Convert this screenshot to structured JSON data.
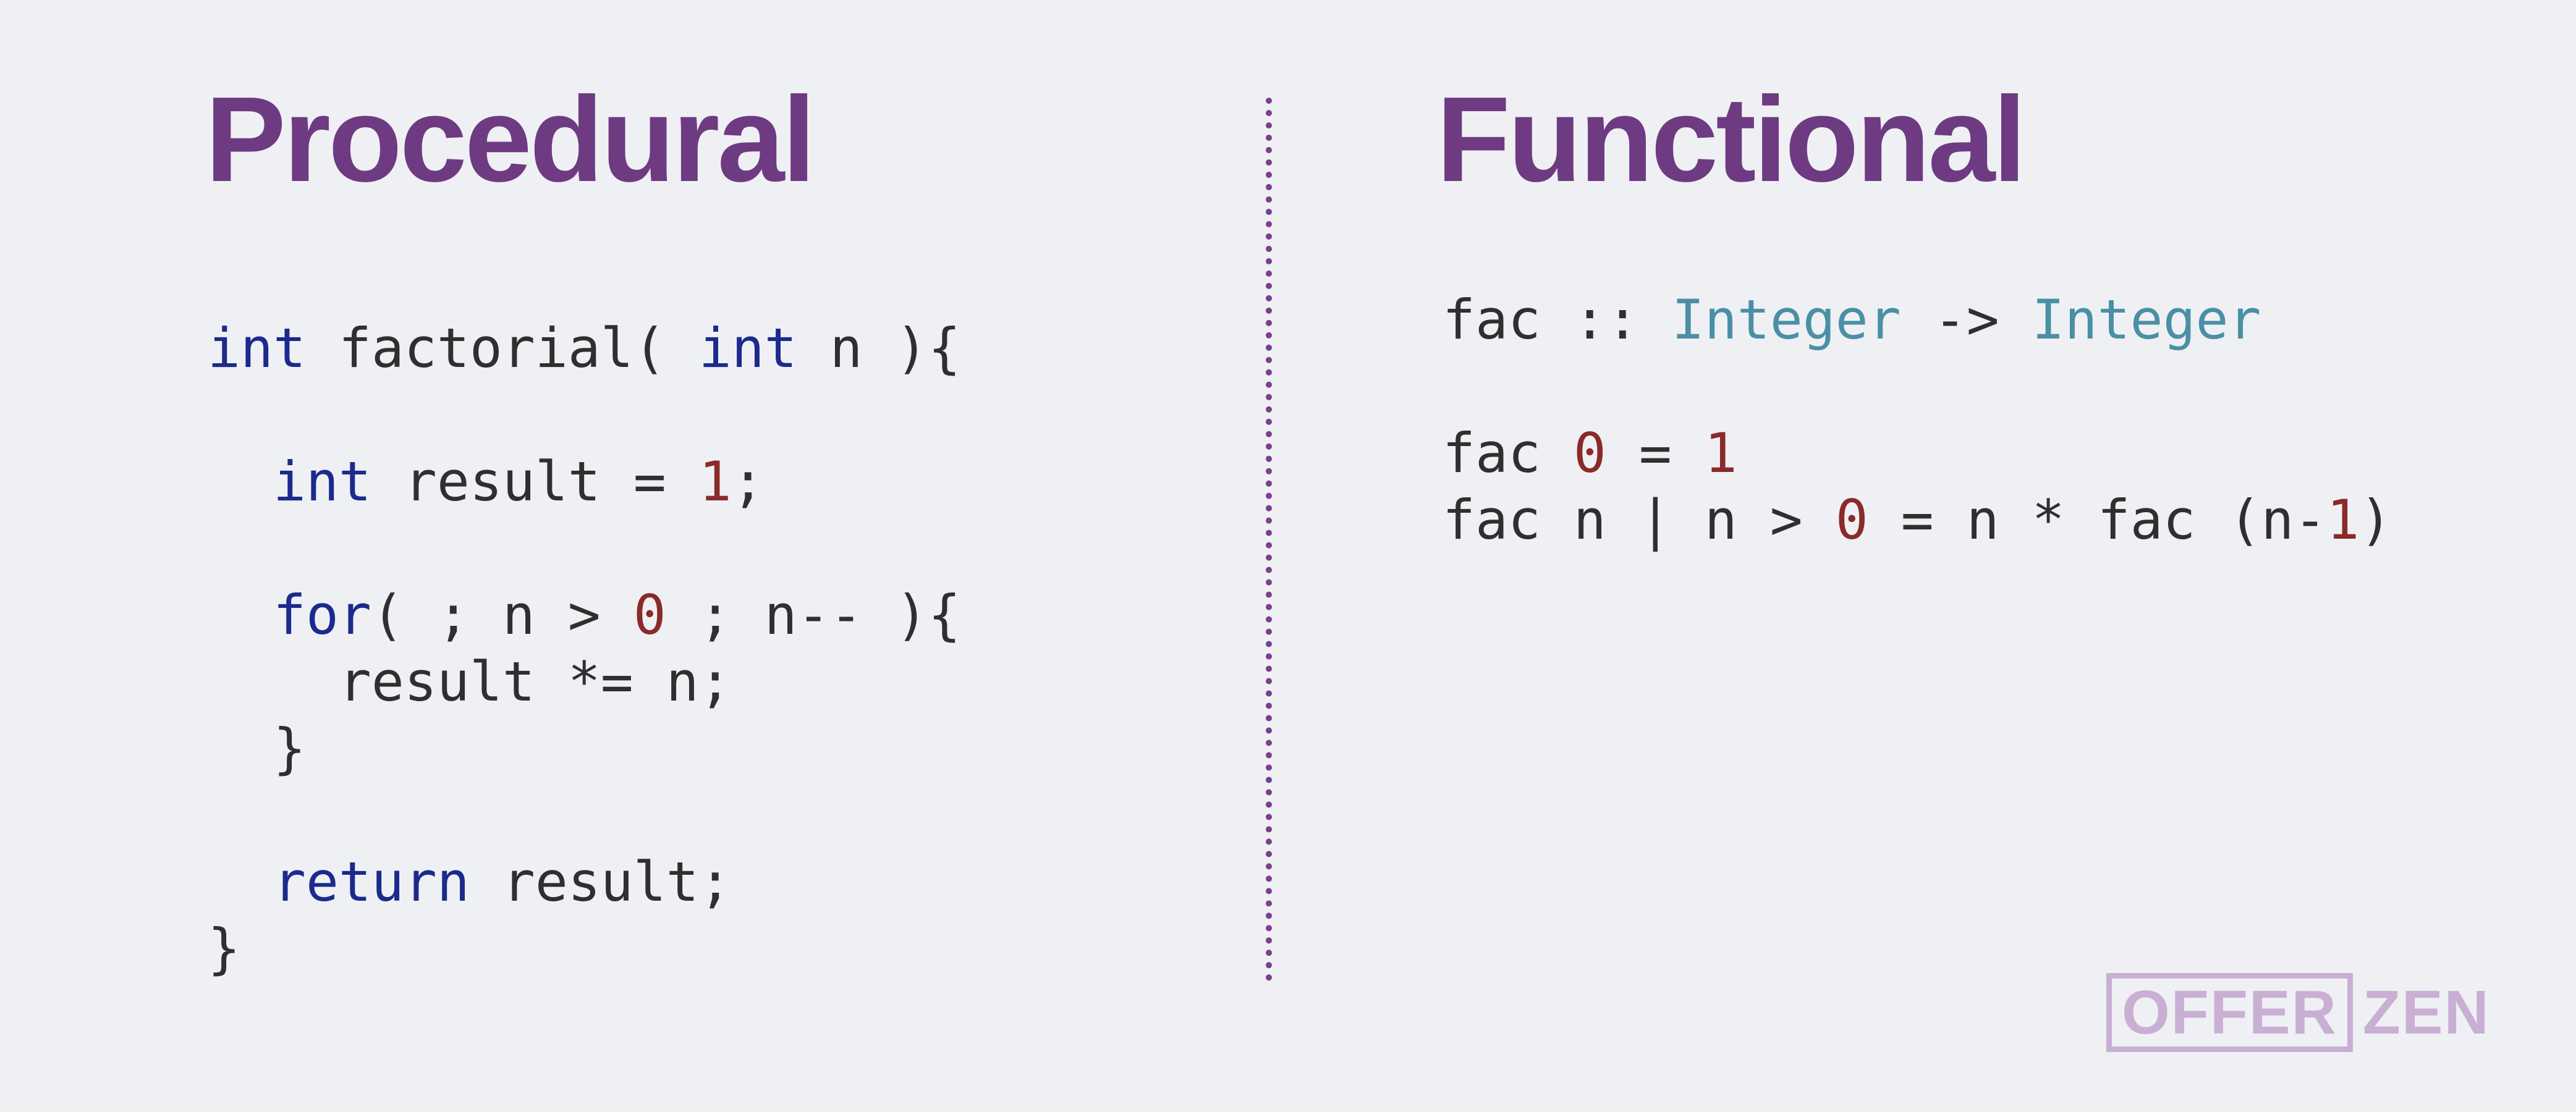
{
  "headings": {
    "left": "Procedural",
    "right": "Functional"
  },
  "procedural_code": {
    "lines": [
      [
        {
          "t": "int",
          "c": "kw"
        },
        {
          "t": " factorial( ",
          "c": "plain"
        },
        {
          "t": "int",
          "c": "kw"
        },
        {
          "t": " n ){",
          "c": "plain"
        }
      ],
      [],
      [
        {
          "t": "  ",
          "c": "plain"
        },
        {
          "t": "int",
          "c": "kw"
        },
        {
          "t": " result = ",
          "c": "plain"
        },
        {
          "t": "1",
          "c": "num"
        },
        {
          "t": ";",
          "c": "plain"
        }
      ],
      [],
      [
        {
          "t": "  ",
          "c": "plain"
        },
        {
          "t": "for",
          "c": "kw"
        },
        {
          "t": "( ; n > ",
          "c": "plain"
        },
        {
          "t": "0",
          "c": "num"
        },
        {
          "t": " ; n-- ){",
          "c": "plain"
        }
      ],
      [
        {
          "t": "    result *= n;",
          "c": "plain"
        }
      ],
      [
        {
          "t": "  }",
          "c": "plain"
        }
      ],
      [],
      [
        {
          "t": "  ",
          "c": "plain"
        },
        {
          "t": "return",
          "c": "kw"
        },
        {
          "t": " result;",
          "c": "plain"
        }
      ],
      [
        {
          "t": "}",
          "c": "plain"
        }
      ]
    ]
  },
  "functional_code": {
    "lines": [
      [
        {
          "t": "fac :: ",
          "c": "plain"
        },
        {
          "t": "Integer",
          "c": "type"
        },
        {
          "t": " -> ",
          "c": "plain"
        },
        {
          "t": "Integer",
          "c": "type"
        }
      ],
      [],
      [
        {
          "t": "fac ",
          "c": "plain"
        },
        {
          "t": "0",
          "c": "num"
        },
        {
          "t": " = ",
          "c": "plain"
        },
        {
          "t": "1",
          "c": "num"
        }
      ],
      [
        {
          "t": "fac n | n > ",
          "c": "plain"
        },
        {
          "t": "0",
          "c": "num"
        },
        {
          "t": " = n * fac (n-",
          "c": "plain"
        },
        {
          "t": "1",
          "c": "num"
        },
        {
          "t": ")",
          "c": "plain"
        }
      ]
    ]
  },
  "logo": {
    "boxed": "OFFER",
    "plain": "ZEN"
  },
  "colors": {
    "heading": "#6e3b82",
    "keyword": "#1b2a8c",
    "number": "#8a2a2a",
    "type": "#4a8fa6",
    "text": "#2f2f2f",
    "background": "#eff0f3",
    "logo": "#c9afd4"
  }
}
